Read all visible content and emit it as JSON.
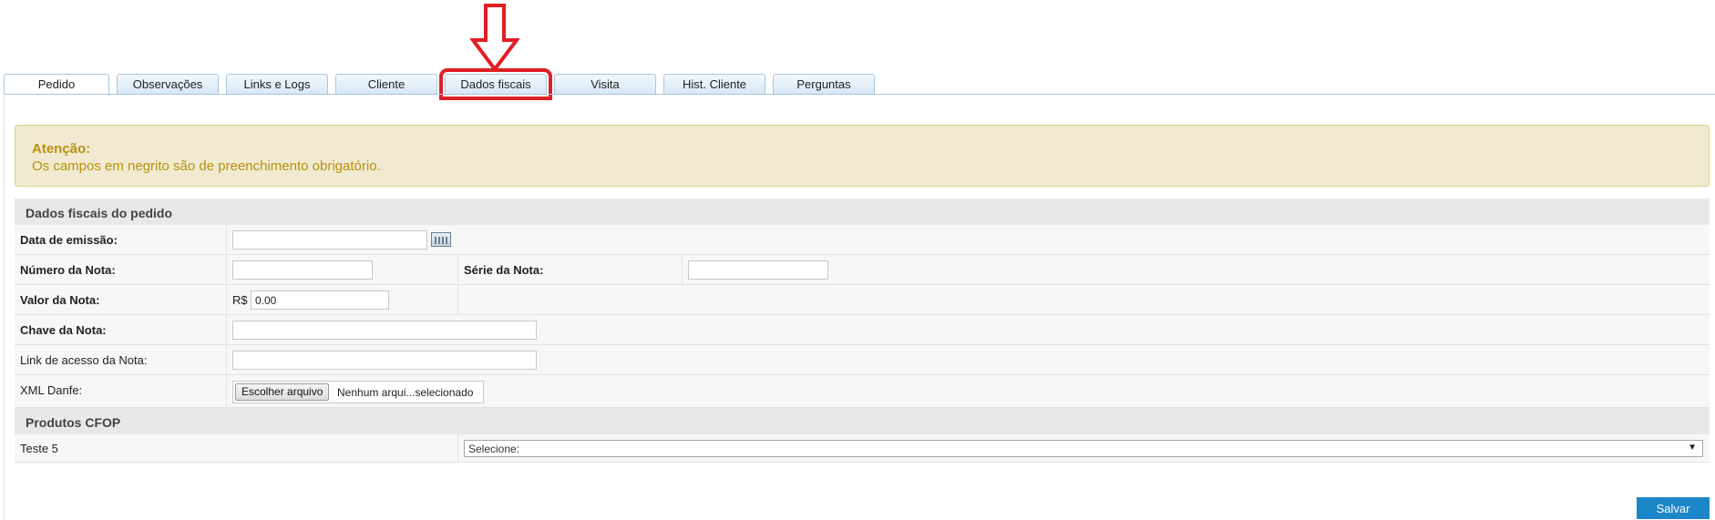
{
  "tabs": [
    {
      "label": "Pedido",
      "active": true
    },
    {
      "label": "Observações"
    },
    {
      "label": "Links e Logs"
    },
    {
      "label": "Cliente"
    },
    {
      "label": "Dados fiscais",
      "highlighted": true
    },
    {
      "label": "Visita"
    },
    {
      "label": "Hist. Cliente"
    },
    {
      "label": "Perguntas"
    }
  ],
  "alert": {
    "title": "Atenção:",
    "message": "Os campos em negrito são de preenchimento obrigatório."
  },
  "dados_fiscais": {
    "section_title": "Dados fiscais do pedido",
    "data_emissao": {
      "label": "Data de emissão:",
      "value": ""
    },
    "numero_nota": {
      "label": "Número da Nota:",
      "value": ""
    },
    "serie_nota": {
      "label": "Série da Nota:",
      "value": ""
    },
    "valor_nota": {
      "label": "Valor da Nota:",
      "currency": "R$",
      "value": "0.00"
    },
    "chave_nota": {
      "label": "Chave da Nota:",
      "value": ""
    },
    "link_nota": {
      "label": "Link de acesso da Nota:",
      "value": ""
    },
    "xml_danfe": {
      "label": "XML Danfe:",
      "button": "Escolher arquivo",
      "status": "Nenhum arqui...selecionado"
    }
  },
  "produtos_cfop": {
    "section_title": "Produtos CFOP",
    "items": [
      {
        "product": "Teste 5",
        "select_value": "Selecione:"
      }
    ]
  },
  "actions": {
    "save_label": "Salvar"
  },
  "colors": {
    "highlight": "#e01f25",
    "primary": "#1b87c9",
    "alert_text": "#b8900f"
  }
}
